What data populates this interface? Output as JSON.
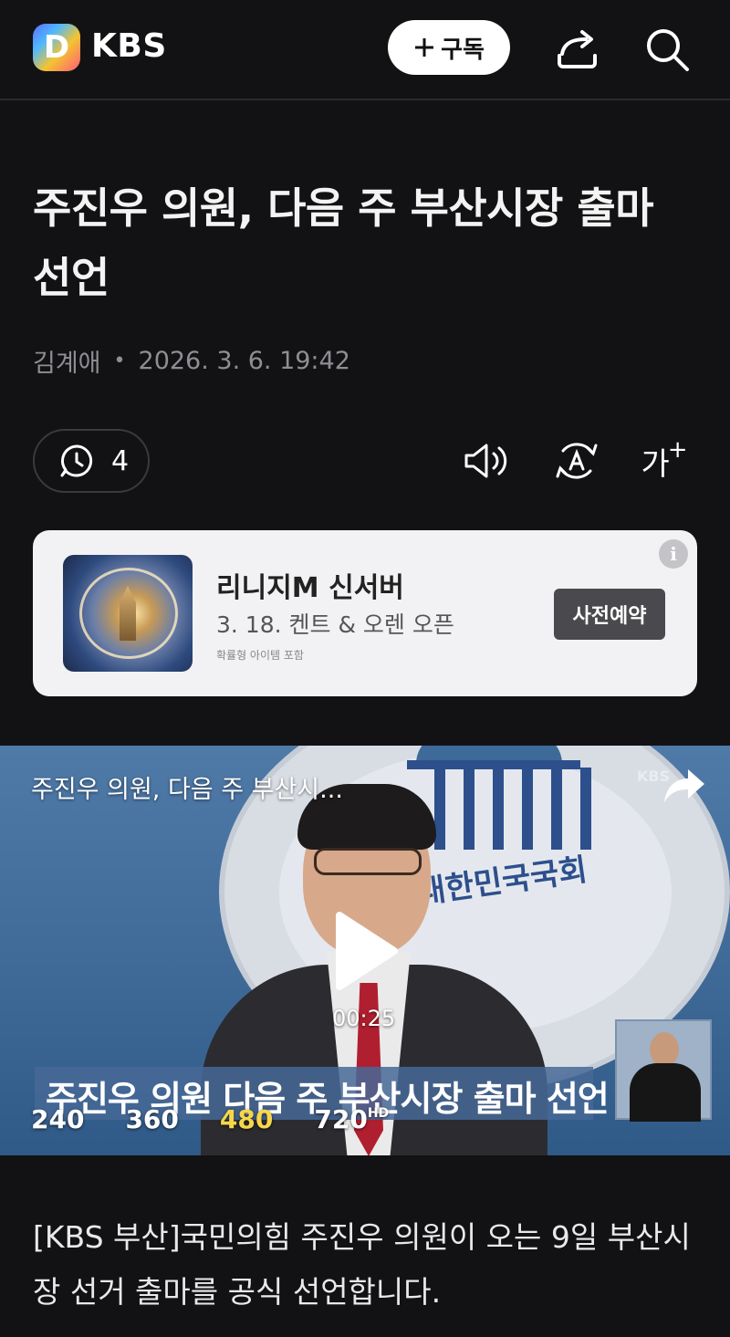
{
  "header": {
    "logo_letter": "D",
    "brand": "KBS",
    "subscribe_label": "구독",
    "icons": [
      "plus-icon",
      "share-icon",
      "search-icon"
    ]
  },
  "article": {
    "title": "주진우 의원, 다음 주 부산시장 출마 선언",
    "author": "김계애",
    "date": "2026. 3. 6. 19:42",
    "comment_count": "4",
    "font_size_label": "가",
    "font_size_plus": "+",
    "body": "[KBS 부산]국민의힘 주진우 의원이 오는 9일 부산시장 선거 출마를 공식 선언합니다."
  },
  "toolbar_icons": [
    "comment-icon",
    "speaker-icon",
    "translate-icon",
    "font-size-icon"
  ],
  "ad": {
    "title": "리니지M 신서버",
    "subtitle": "3. 18. 켄트 & 오렌  오픈",
    "note": "확률형 아이템 포함",
    "button": "사전예약",
    "info": "i"
  },
  "video": {
    "title": "주진우 의원, 다음 주 부산시...",
    "watermark": "KBS",
    "emblem_text": "대한민국국회",
    "caption": "주진우 의원  다음 주 부산시장 출마 선언",
    "duration": "00:25",
    "qualities": [
      "240",
      "360",
      "480",
      "720"
    ],
    "hd_label": "HD",
    "selected_quality": "480"
  },
  "colors": {
    "background": "#121214",
    "ad_card": "#f2f2f4",
    "quality_active": "#f7d64a"
  }
}
